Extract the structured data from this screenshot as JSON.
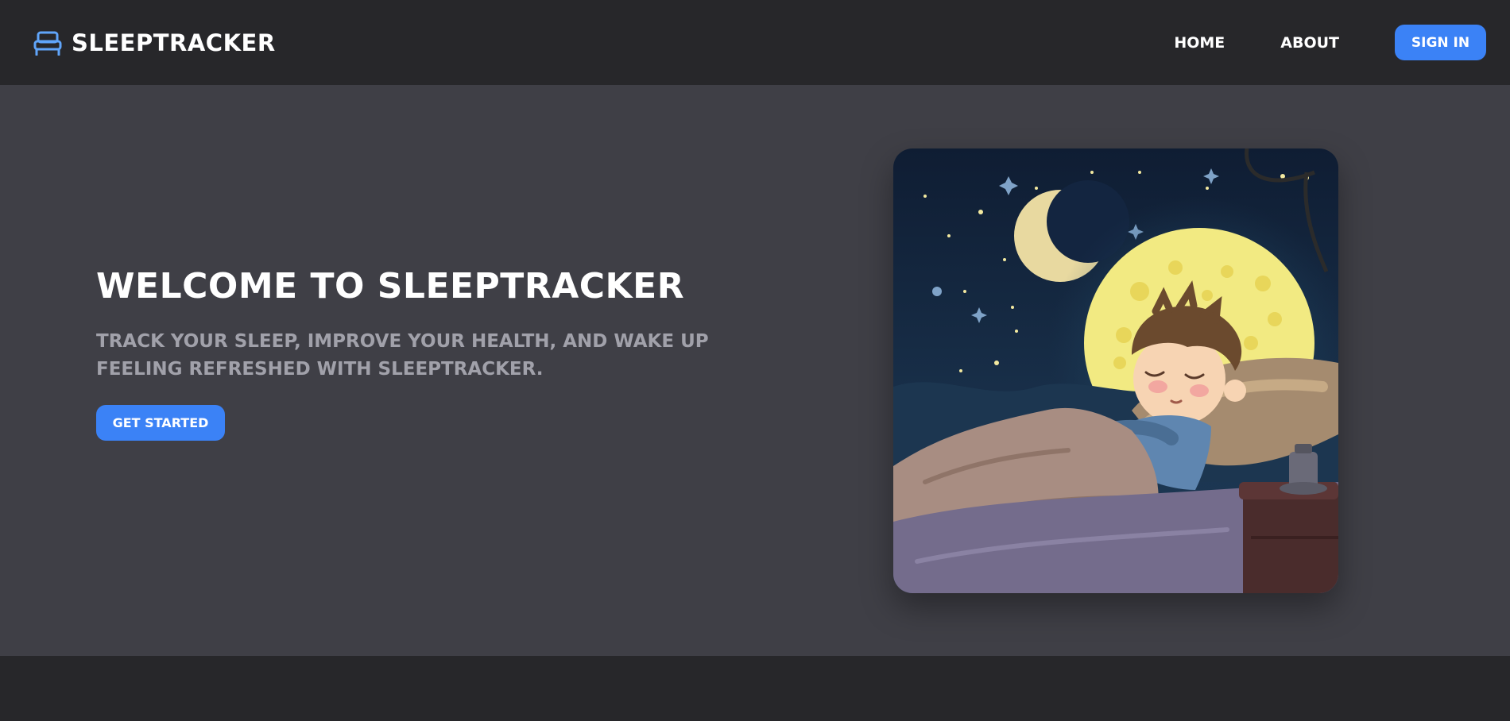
{
  "header": {
    "brand_name": "SLEEPTRACKER",
    "brand_icon": "bed-icon",
    "nav_links": [
      {
        "label": "HOME"
      },
      {
        "label": "ABOUT"
      }
    ],
    "sign_in_label": "SIGN IN"
  },
  "hero": {
    "title": "WELCOME TO SLEEPTRACKER",
    "subtitle": "TRACK YOUR SLEEP, IMPROVE YOUR HEALTH, AND WAKE UP FEELING REFRESHED WITH SLEEPTRACKER.",
    "cta_label": "GET STARTED",
    "image": "sleeping-boy-illustration"
  },
  "colors": {
    "header_bg": "#27272a",
    "hero_bg": "#3f3f46",
    "accent": "#3b82f6",
    "icon_blue": "#60a5fa",
    "subtitle": "#a1a1aa"
  }
}
